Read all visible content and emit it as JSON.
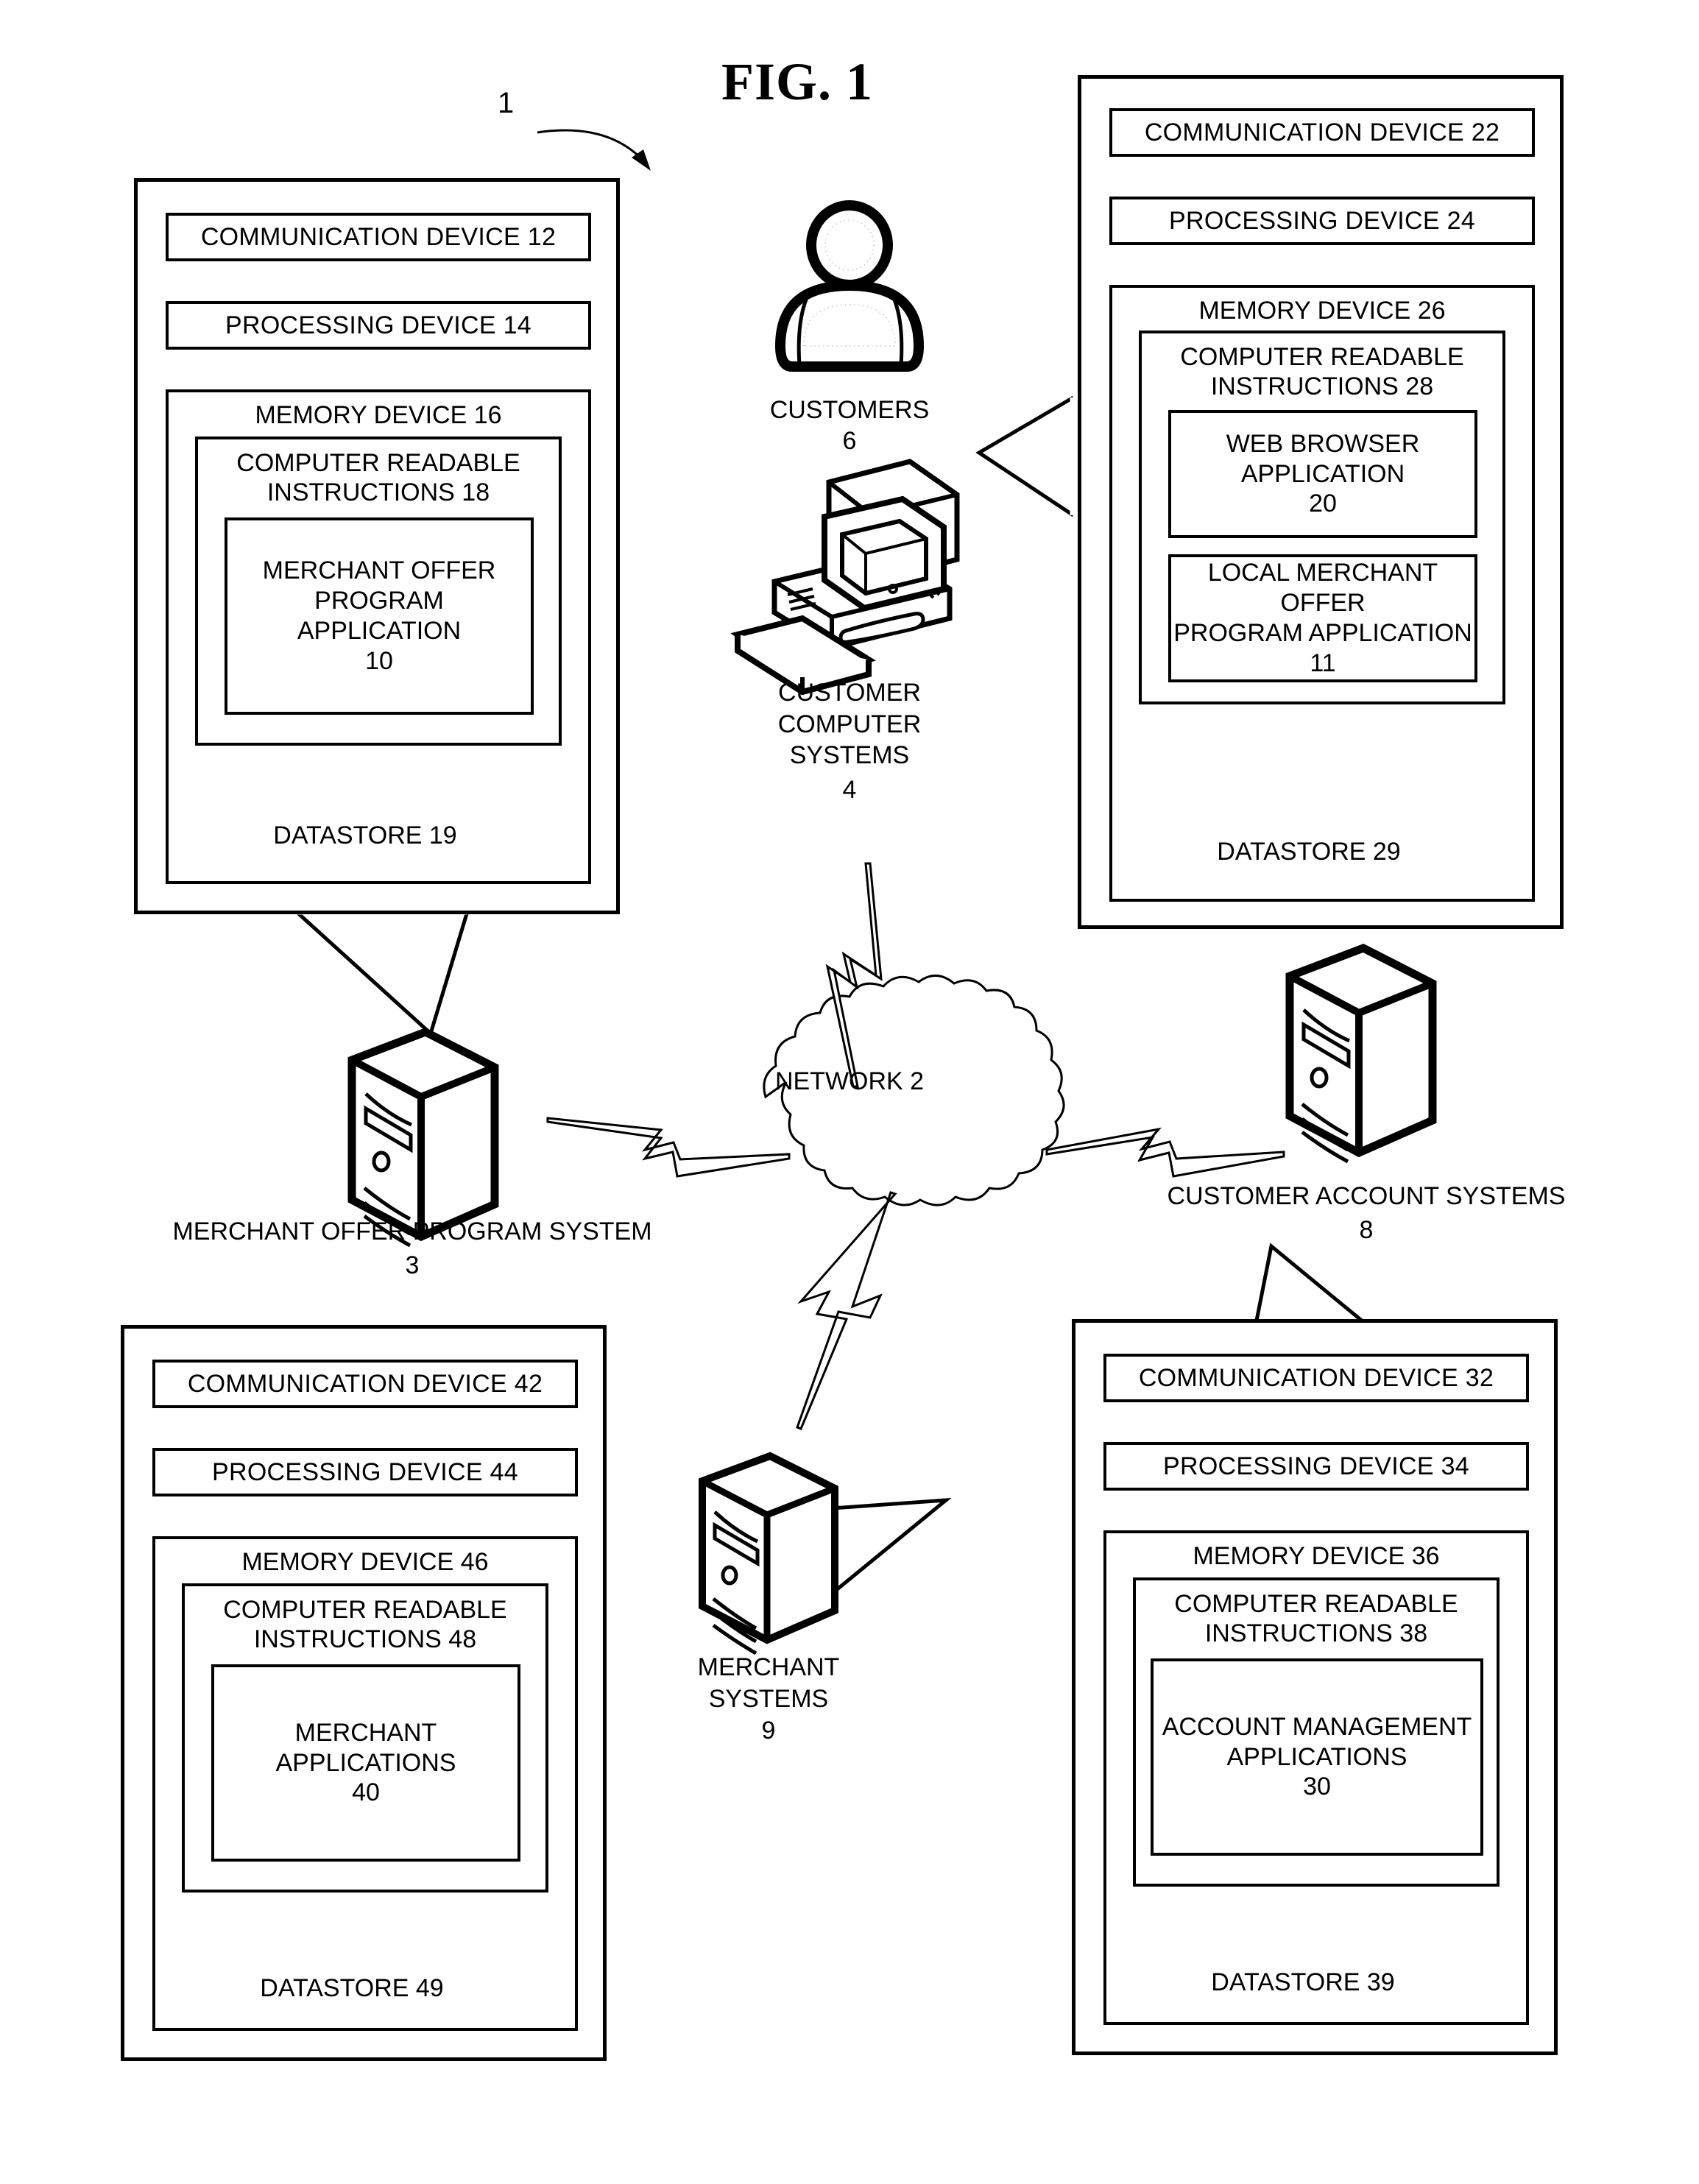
{
  "figure": {
    "title": "FIG. 1",
    "system_ref": "1"
  },
  "network": {
    "label": "NETWORK 2"
  },
  "nodes": {
    "customers": {
      "label": "CUSTOMERS",
      "ref": "6"
    },
    "customer_computer_systems": {
      "label": "CUSTOMER\nCOMPUTER\nSYSTEMS",
      "ref": "4"
    },
    "merchant_offer_program_system": {
      "label": "MERCHANT OFFER PROGRAM SYSTEM",
      "ref": "3"
    },
    "customer_account_systems": {
      "label": "CUSTOMER ACCOUNT SYSTEMS",
      "ref": "8"
    },
    "merchant_systems": {
      "label": "MERCHANT\nSYSTEMS",
      "ref": "9"
    }
  },
  "panels": {
    "merchant_offer_program": {
      "communication_device": "COMMUNICATION DEVICE 12",
      "processing_device": "PROCESSING DEVICE 14",
      "memory_device": "MEMORY DEVICE 16",
      "computer_readable_instructions": "COMPUTER READABLE\nINSTRUCTIONS 18",
      "application": "MERCHANT OFFER\nPROGRAM\nAPPLICATION\n10",
      "datastore": "DATASTORE 19"
    },
    "customer_computer": {
      "communication_device": "COMMUNICATION DEVICE 22",
      "processing_device": "PROCESSING DEVICE 24",
      "memory_device": "MEMORY DEVICE 26",
      "computer_readable_instructions": "COMPUTER READABLE\nINSTRUCTIONS 28",
      "application_1": "WEB BROWSER\nAPPLICATION\n20",
      "application_2": "LOCAL MERCHANT OFFER\nPROGRAM APPLICATION\n11",
      "datastore": "DATASTORE 29"
    },
    "merchant": {
      "communication_device": "COMMUNICATION DEVICE 42",
      "processing_device": "PROCESSING DEVICE 44",
      "memory_device": "MEMORY DEVICE 46",
      "computer_readable_instructions": "COMPUTER READABLE\nINSTRUCTIONS 48",
      "application": "MERCHANT\nAPPLICATIONS\n40",
      "datastore": "DATASTORE 49"
    },
    "customer_account": {
      "communication_device": "COMMUNICATION DEVICE 32",
      "processing_device": "PROCESSING DEVICE 34",
      "memory_device": "MEMORY DEVICE 36",
      "computer_readable_instructions": "COMPUTER READABLE\nINSTRUCTIONS 38",
      "application": "ACCOUNT MANAGEMENT\nAPPLICATIONS\n30",
      "datastore": "DATASTORE 39"
    }
  },
  "colors": {
    "ink": "#000000",
    "paper": "#ffffff"
  }
}
